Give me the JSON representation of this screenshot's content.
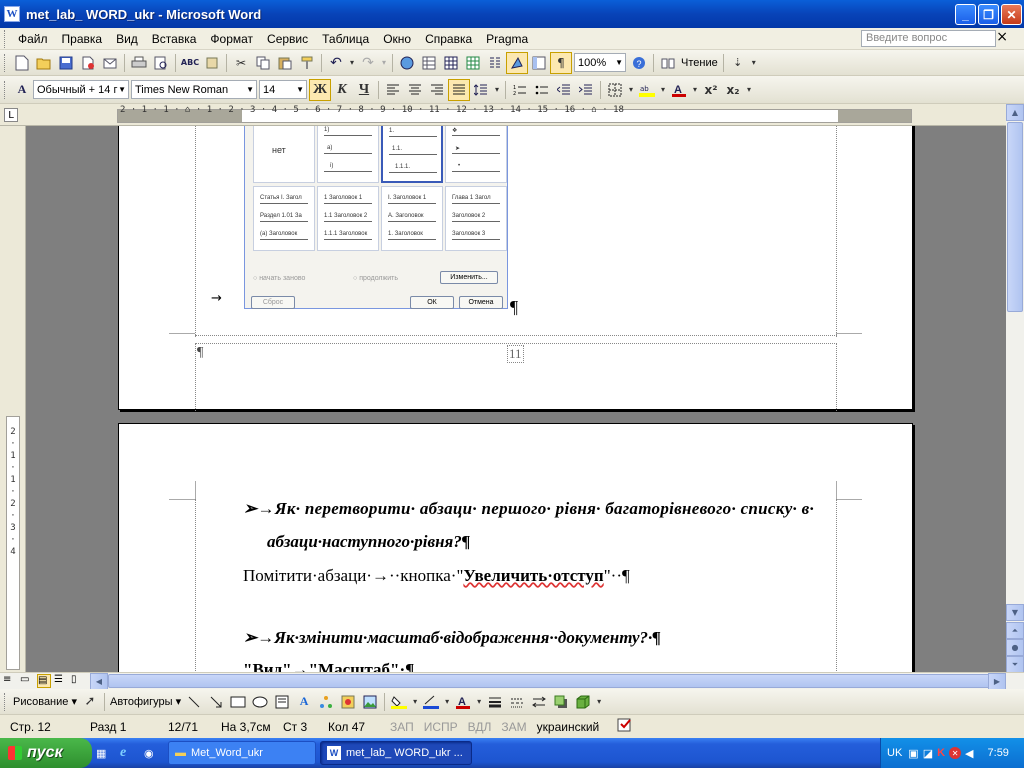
{
  "window": {
    "title": "met_lab_ WORD_ukr - Microsoft Word",
    "app_icon": "W",
    "minimize": "_",
    "maximize": "❐",
    "close": "✕"
  },
  "menu": {
    "items": [
      "Файл",
      "Правка",
      "Вид",
      "Вставка",
      "Формат",
      "Сервис",
      "Таблица",
      "Окно",
      "Справка",
      "Pragma"
    ],
    "help_placeholder": "Введите вопрос",
    "close": "×"
  },
  "toolbar_standard": {
    "zoom": "100%",
    "read_label": "Чтение",
    "pilcrow": "¶"
  },
  "toolbar_format": {
    "style": "Обычный + 14 г",
    "font": "Times New Roman",
    "size": "14",
    "bold": "Ж",
    "italic": "К",
    "underline": "Ч",
    "superscript": "x²",
    "subscript": "x₂"
  },
  "ruler": {
    "tab_selector": "L",
    "text": "2 · 1 · 1 · ⌂ · 1 · 2 · 3 · 4 · 5 · 6 · 7 · 8 · 9 · 10 · 11 · 12 · 13 · 14 · 15 · 16 · ⌂ · 18"
  },
  "vruler": {
    "text": "2 · 1 · 1 · 2 · 3 · 4"
  },
  "page1": {
    "dialog": {
      "cells": [
        {
          "lines": [
            "нет"
          ]
        },
        {
          "lines": [
            "1)",
            "а)",
            "i)"
          ]
        },
        {
          "lines": [
            "1.",
            "1.1.",
            "1.1.1."
          ]
        },
        {
          "lines": [
            "❖",
            "➤",
            "•"
          ]
        },
        {
          "lines": [
            "Статья I. Загол",
            "Раздел 1.01 За",
            "(а) Заголовок"
          ]
        },
        {
          "lines": [
            "1 Заголовок 1",
            "1.1 Заголовок 2",
            "1.1.1 Заголовок"
          ]
        },
        {
          "lines": [
            "I. Заголовок 1",
            "A. Заголовок",
            "1. Заголовок"
          ]
        },
        {
          "lines": [
            "Глава 1 Загол",
            "Заголовок 2",
            "Заголовок 3"
          ]
        }
      ],
      "radio_restart": "начать заново",
      "radio_continue": "продолжить",
      "btn_change": "Изменить...",
      "btn_reset": "Сброс",
      "btn_ok": "ОК",
      "btn_cancel": "Отмена"
    },
    "tab_arrow": "→",
    "para_mark": "¶",
    "footer_para": "¶",
    "page_number": "11"
  },
  "page2": {
    "q1_line1": "➢→Як· перетворити· абзаци· першого· рівня· багаторівневого· списку· в·",
    "q1_line2": "абзаци·наступного·рівня?¶",
    "a1_prefix": "Помітити·абзаци·→··кнопка·\"",
    "a1_bold": "Увеличить·отступ",
    "a1_suffix": "\"··¶",
    "q2": "➢→Як·змінити·масштаб·відображення··документу?·¶",
    "a2_partial": "\"Вид\"→\"Масштаб\"·¶"
  },
  "drawing_toolbar": {
    "draw_label": "Рисование ▾",
    "autoshapes_label": "Автофигуры ▾"
  },
  "status": {
    "page": "Стр. 12",
    "section": "Разд 1",
    "pages": "12/71",
    "at": "На 3,7см",
    "line": "Ст 3",
    "col": "Кол 47",
    "rec": "ЗАП",
    "trk": "ИСПР",
    "ext": "ВДЛ",
    "ovr": "ЗАМ",
    "lang": "украинский"
  },
  "taskbar": {
    "start": "пуск",
    "items": [
      "Met_Word_ukr",
      "met_lab_ WORD_ukr ..."
    ],
    "lang": "UK",
    "clock": "7:59"
  }
}
